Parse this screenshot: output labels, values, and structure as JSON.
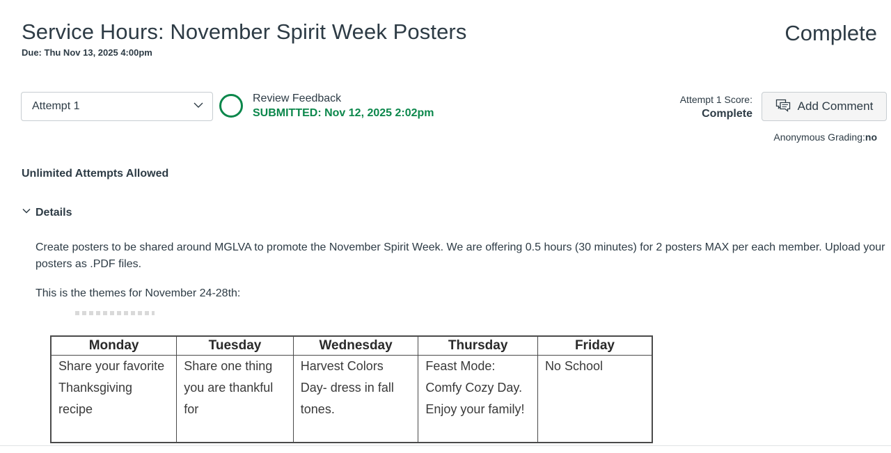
{
  "assignment": {
    "title": "Service Hours: November Spirit Week Posters",
    "due": "Due: Thu Nov 13, 2025 4:00pm",
    "grade_status": "Complete"
  },
  "attempt": {
    "selected": "Attempt 1",
    "review_feedback": "Review Feedback",
    "submitted": "SUBMITTED: Nov 12, 2025 2:02pm",
    "score_label": "Attempt 1 Score:",
    "score_value": "Complete",
    "add_comment_label": "Add Comment",
    "anonymous_label": "Anonymous Grading:",
    "anonymous_value": "no",
    "status_color": "#0b874b"
  },
  "attempts_allowed": "Unlimited Attempts Allowed",
  "details": {
    "toggle_label": "Details",
    "description": "Create posters to be shared around MGLVA to promote the November Spirit Week. We are offering 0.5 hours (30 minutes) for 2 posters MAX per each member. Upload your posters as .PDF files.",
    "themes_intro": "This is the themes for November 24-28th:"
  },
  "themes_table": {
    "headers": [
      "Monday",
      "Tuesday",
      "Wednesday",
      "Thursday",
      "Friday"
    ],
    "cells": [
      "Share your favorite Thanksgiving recipe",
      "Share one thing you are thankful for",
      "Harvest Colors Day- dress in fall tones.",
      "Feast Mode: Comfy Cozy Day. Enjoy your family!",
      "No School"
    ]
  },
  "icons": {
    "dropdown": "chevron-down-icon",
    "comment": "comment-icon",
    "details": "chevron-down-icon",
    "status": "circle-outline-icon"
  }
}
